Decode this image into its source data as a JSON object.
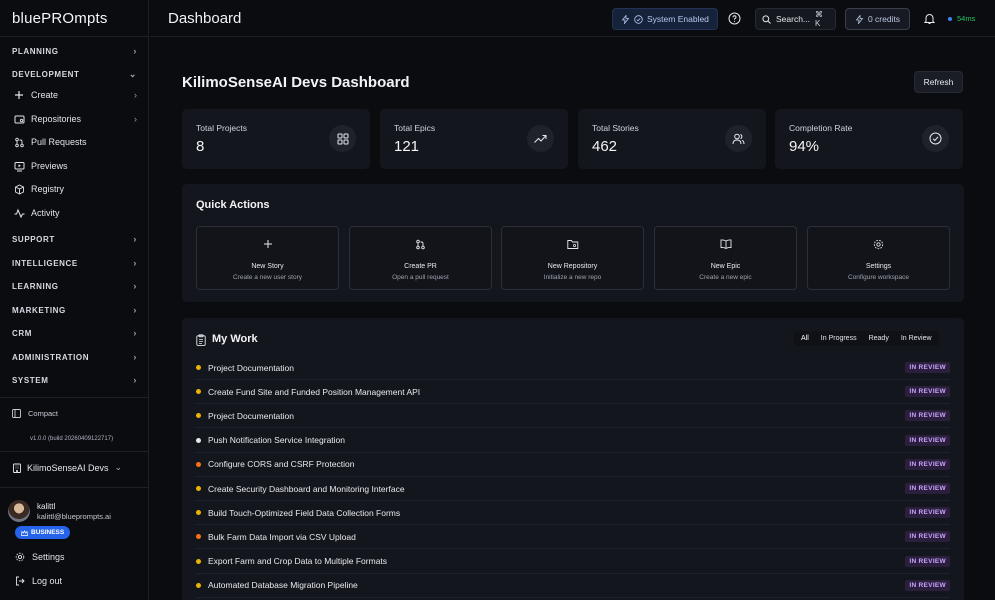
{
  "app": {
    "logo": "bluePROmpts"
  },
  "sidebar": {
    "sections": [
      {
        "key": "planning",
        "label": "PLANNING"
      },
      {
        "key": "development",
        "label": "DEVELOPMENT"
      },
      {
        "key": "support",
        "label": "SUPPORT"
      },
      {
        "key": "intelligence",
        "label": "INTELLIGENCE"
      },
      {
        "key": "learning",
        "label": "LEARNING"
      },
      {
        "key": "marketing",
        "label": "MARKETING"
      },
      {
        "key": "crm",
        "label": "CRM"
      },
      {
        "key": "administration",
        "label": "ADMINISTRATION"
      },
      {
        "key": "system",
        "label": "SYSTEM"
      }
    ],
    "dev_items": [
      {
        "label": "Create",
        "icon": "plus-icon"
      },
      {
        "label": "Repositories",
        "icon": "repo-icon"
      },
      {
        "label": "Pull Requests",
        "icon": "pull-request-icon"
      },
      {
        "label": "Previews",
        "icon": "preview-icon"
      },
      {
        "label": "Registry",
        "icon": "package-icon"
      },
      {
        "label": "Activity",
        "icon": "activity-icon"
      }
    ],
    "compact_label": "Compact",
    "version": "v1.0.0 (build 20260409122717)",
    "workspace": "KilimoSenseAI Devs",
    "user": {
      "name": "kalittl",
      "email": "kalittl@blueprompts.ai",
      "plan": "BUSINESS"
    },
    "settings_label": "Settings",
    "logout_label": "Log out"
  },
  "topbar": {
    "title": "Dashboard",
    "system_status": "System Enabled",
    "search_label": "Search...",
    "search_shortcut": "⌘ K",
    "credits": "0 credits",
    "latency": "54ms"
  },
  "main": {
    "title": "KilimoSenseAI Devs Dashboard",
    "refresh_label": "Refresh",
    "stats": [
      {
        "label": "Total Projects",
        "value": "8",
        "icon": "grid-icon"
      },
      {
        "label": "Total Epics",
        "value": "121",
        "icon": "trend-up-icon"
      },
      {
        "label": "Total Stories",
        "value": "462",
        "icon": "users-icon"
      },
      {
        "label": "Completion Rate",
        "value": "94%",
        "icon": "check-circle-icon"
      }
    ],
    "quick_actions": {
      "title": "Quick Actions",
      "items": [
        {
          "title": "New Story",
          "subtitle": "Create a new user story",
          "icon": "plus-icon"
        },
        {
          "title": "Create PR",
          "subtitle": "Open a pull request",
          "icon": "pull-request-icon"
        },
        {
          "title": "New Repository",
          "subtitle": "Initialize a new repo",
          "icon": "folder-git-icon"
        },
        {
          "title": "New Epic",
          "subtitle": "Create a new epic",
          "icon": "book-icon"
        },
        {
          "title": "Settings",
          "subtitle": "Configure workspace",
          "icon": "gear-icon"
        }
      ]
    },
    "my_work": {
      "title": "My Work",
      "filters": [
        "All",
        "In Progress",
        "Ready",
        "In Review"
      ],
      "active_filter": "All",
      "rows": [
        {
          "title": "Project Documentation",
          "status": "IN REVIEW",
          "priority_color": "#eab308"
        },
        {
          "title": "Create Fund Site and Funded Position Management API",
          "status": "IN REVIEW",
          "priority_color": "#eab308"
        },
        {
          "title": "Project Documentation",
          "status": "IN REVIEW",
          "priority_color": "#eab308"
        },
        {
          "title": "Push Notification Service Integration",
          "status": "IN REVIEW",
          "priority_color": "#e5e7eb"
        },
        {
          "title": "Configure CORS and CSRF Protection",
          "status": "IN REVIEW",
          "priority_color": "#f97316"
        },
        {
          "title": "Create Security Dashboard and Monitoring Interface",
          "status": "IN REVIEW",
          "priority_color": "#eab308"
        },
        {
          "title": "Build Touch-Optimized Field Data Collection Forms",
          "status": "IN REVIEW",
          "priority_color": "#eab308"
        },
        {
          "title": "Bulk Farm Data Import via CSV Upload",
          "status": "IN REVIEW",
          "priority_color": "#f97316"
        },
        {
          "title": "Export Farm and Crop Data to Multiple Formats",
          "status": "IN REVIEW",
          "priority_color": "#eab308"
        },
        {
          "title": "Automated Database Migration Pipeline",
          "status": "IN REVIEW",
          "priority_color": "#eab308"
        }
      ]
    }
  },
  "colors": {
    "accent": "#2563eb",
    "status_review_bg": "#2b1f3d",
    "status_review_fg": "#c9a3ff",
    "latency": "#22c55e"
  }
}
